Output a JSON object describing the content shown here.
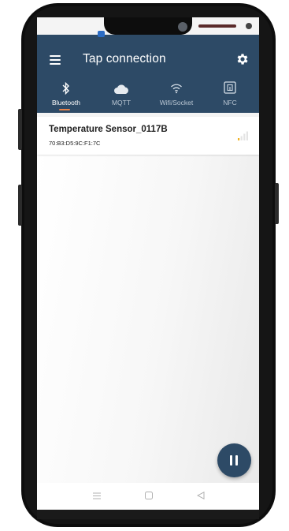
{
  "app": {
    "title": "Tap connection",
    "menu_icon": "menu-icon",
    "settings_icon": "gear-icon",
    "bar_color": "#2d4a66",
    "accent_color": "#e8834a"
  },
  "tabs": [
    {
      "label": "Bluetooth",
      "icon": "bluetooth-icon",
      "active": true
    },
    {
      "label": "MQTT",
      "icon": "cloud-icon",
      "active": false
    },
    {
      "label": "Wifi/Socket",
      "icon": "wifi-icon",
      "active": false
    },
    {
      "label": "NFC",
      "icon": "nfc-icon",
      "active": false
    }
  ],
  "devices": [
    {
      "name": "Temperature Sensor_0117B",
      "mac": "70:B3:D5:9C:F1:7C",
      "icon": "signal-strength-icon",
      "signal_level": 0.25
    }
  ],
  "fab": {
    "icon": "pause-icon"
  },
  "nav": {
    "buttons": [
      "menu-nav-icon",
      "home-nav-icon",
      "back-nav-icon"
    ]
  }
}
